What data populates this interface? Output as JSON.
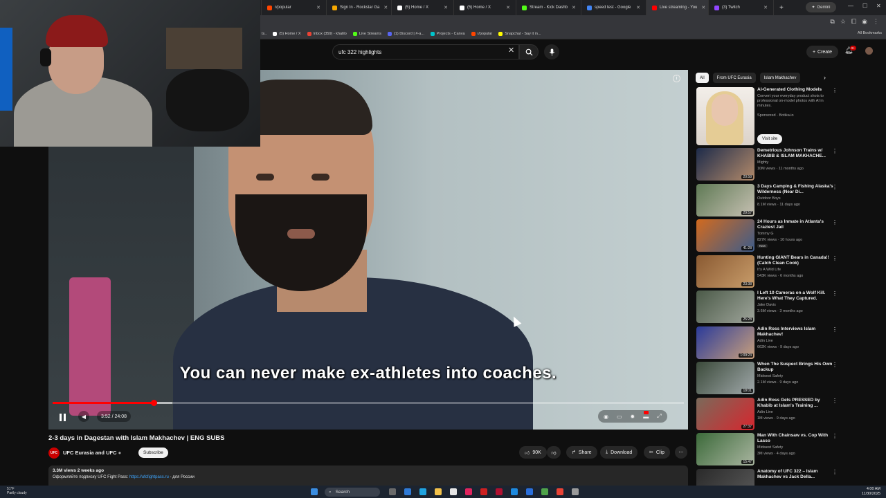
{
  "browser": {
    "tabs": [
      {
        "label": "r/popular",
        "color": "#ff4500"
      },
      {
        "label": "Sign In - Rockstar Ga",
        "color": "#f6a800"
      },
      {
        "label": "(5) Home / X",
        "color": "#ffffff"
      },
      {
        "label": "(5) Home / X",
        "color": "#ffffff"
      },
      {
        "label": "Stream - Kick Dashb",
        "color": "#53fc18"
      },
      {
        "label": "speed test - Google",
        "color": "#4285f4"
      },
      {
        "label": "Live streaming - You",
        "color": "#ff0000"
      },
      {
        "label": "(3) Twitch",
        "color": "#9146ff"
      }
    ],
    "gemini_label": "Gemini",
    "bookmarks": [
      {
        "label": "(5) Home / X",
        "color": "#ffffff"
      },
      {
        "label": "Inbox (359) - khalilo",
        "color": "#ea4335"
      },
      {
        "label": "Live Streams",
        "color": "#53fc18"
      },
      {
        "label": "(1) Discord | #-a...",
        "color": "#5865f2"
      },
      {
        "label": "Projects - Canva",
        "color": "#00c4cc"
      },
      {
        "label": "r/popular",
        "color": "#ff4500"
      },
      {
        "label": "Snapchat - Say it in...",
        "color": "#fffc00"
      }
    ],
    "all_bookmarks": "All Bookmarks"
  },
  "header": {
    "search_value": "ufc 322 highlights",
    "create_label": "Create",
    "notif_count": "9+"
  },
  "player": {
    "subtitle": "You can never make ex-athletes into coaches.",
    "time": "3:52 / 24:08",
    "progress": 0.16,
    "buffered": 0.19
  },
  "video": {
    "title": "2-3 days in Dagestan with Islam Makhachev | ENG SUBS",
    "channel": "UFC Eurasia and UFC",
    "channel_logo": "UFC",
    "subscribe": "Subscribe",
    "likes": "90K",
    "share": "Share",
    "download": "Download",
    "clip": "Clip",
    "stats": "3.3M views  2 weeks ago",
    "desc_prefix": "Оформляйте подписку UFC Fight Pass: ",
    "desc_link": "https://ufcfightpass.ru",
    "desc_suffix": " - для России"
  },
  "sidebar": {
    "chips": [
      "All",
      "From UFC Eurasia",
      "Islam Makhachev"
    ],
    "ad": {
      "title": "AI-Generated Clothing Models",
      "desc": "Convert your everyday product shots to professional on-model photos with AI in minutes.",
      "sponsor": "Sponsored · Botika.io",
      "cta": "Visit site"
    },
    "recs": [
      {
        "title": "Demetrious Johnson Trains w/ KHABIB & ISLAM MAKHACHE...",
        "channel": "Mighty",
        "meta": "10M views · 11 months ago",
        "dur": "20:58",
        "c1": "#1d2b4a",
        "c2": "#b38a6a",
        "new": ""
      },
      {
        "title": "3 Days Camping & Fishing Alaska's Wilderness (Near Di...",
        "channel": "Outdoor Boys",
        "meta": "8.1M views · 11 days ago",
        "dur": "29:57",
        "c1": "#5f7a55",
        "c2": "#c6c0b2",
        "new": ""
      },
      {
        "title": "24 Hours as Inmate in Atlanta's Craziest Jail",
        "channel": "Tommy G",
        "meta": "827K views · 10 hours ago",
        "dur": "41:28",
        "c1": "#d26a1e",
        "c2": "#3d5c8a",
        "new": "New"
      },
      {
        "title": "Hunting GIANT Bears in Canada!! (Catch Clean Cook)",
        "channel": "It's A Wild Life",
        "meta": "543K views · 6 months ago",
        "dur": "23:38",
        "c1": "#8a5a32",
        "c2": "#c89c6a",
        "new": ""
      },
      {
        "title": "I Left 10 Cameras on a Wolf Kill. Here's What They Captured.",
        "channel": "Jake Davis",
        "meta": "3.6M views · 3 months ago",
        "dur": "25:28",
        "c1": "#4b5a48",
        "c2": "#9ea49a",
        "new": ""
      },
      {
        "title": "Adin Ross Interviews Islam Makhachev!",
        "channel": "Adin Live",
        "meta": "662K views · 9 days ago",
        "dur": "1:09:23",
        "c1": "#2a3a9a",
        "c2": "#c9a07c",
        "new": ""
      },
      {
        "title": "When The Suspect Brings His Own Backup",
        "channel": "Midwest Safety",
        "meta": "2.1M views · 9 days ago",
        "dur": "18:01",
        "c1": "#3b4a3a",
        "c2": "#a0a8aa",
        "new": ""
      },
      {
        "title": "Adin Ross Gets PRESSED by Khabib at Islam's Training ...",
        "channel": "Adin Live",
        "meta": "1M views · 9 days ago",
        "dur": "27:37",
        "c1": "#7a6a5a",
        "c2": "#d7262e",
        "new": ""
      },
      {
        "title": "Man With Chainsaw vs. Cop With Lasso",
        "channel": "Midwest Safety",
        "meta": "3M views · 4 days ago",
        "dur": "15:47",
        "c1": "#3c6a3a",
        "c2": "#a9b5a0",
        "new": ""
      },
      {
        "title": "Anatomy of UFC 322 – Islam Makhachev vs Jack Della...",
        "channel": "",
        "meta": "",
        "dur": "",
        "c1": "#2a2a2a",
        "c2": "#5a5a5a",
        "new": ""
      }
    ]
  },
  "taskbar": {
    "weather_temp": "51°F",
    "weather_desc": "Partly cloudy",
    "search": "Search",
    "time": "4:00 AM",
    "date": "11/30/2025"
  }
}
